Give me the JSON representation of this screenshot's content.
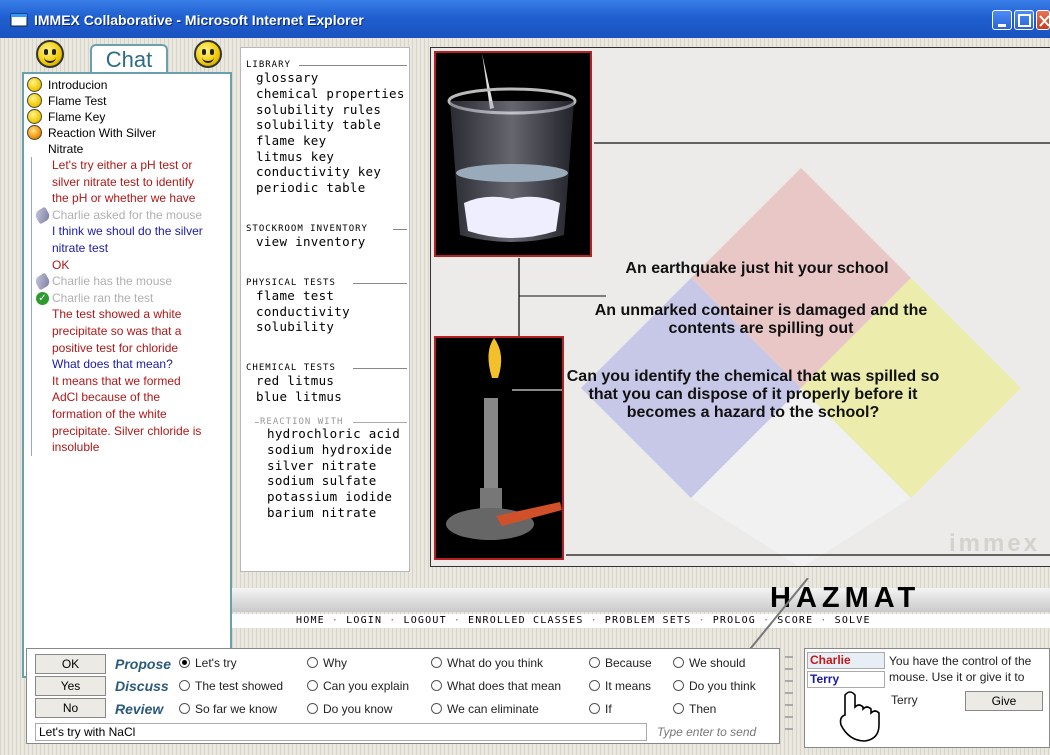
{
  "window": {
    "title": "IMMEX Collaborative - Microsoft Internet Explorer"
  },
  "chat": {
    "tab_label": "Chat",
    "topics": [
      "Introducion",
      "Flame Test",
      "Flame Key",
      "Reaction With Silver Nitrate"
    ],
    "messages": [
      {
        "text": "Let's try either a pH test or silver nitrate test to identify the pH or whether we have",
        "color": "red",
        "icon": ""
      },
      {
        "text": "Charlie asked for the mouse",
        "color": "gray",
        "icon": "mouse"
      },
      {
        "text": "I think we shoul do the silver nitrate test",
        "color": "blue",
        "icon": ""
      },
      {
        "text": "OK",
        "color": "red",
        "icon": ""
      },
      {
        "text": "Charlie has the mouse",
        "color": "gray",
        "icon": "mouse"
      },
      {
        "text": "Charlie ran the test",
        "color": "gray",
        "icon": "check"
      },
      {
        "text": "The test showed a white precipitate so was that a positive test for chloride",
        "color": "red",
        "icon": ""
      },
      {
        "text": "What does that mean?",
        "color": "blue",
        "icon": ""
      },
      {
        "text": "It means that we formed AdCl because of the formation of the white precipitate. Silver chloride is insoluble",
        "color": "red",
        "icon": ""
      }
    ]
  },
  "library": {
    "sections": {
      "library": {
        "title": "LIBRARY",
        "items": [
          "glossary",
          "chemical properties",
          "solubility rules",
          "solubility table",
          "flame key",
          "litmus key",
          "conductivity key",
          "periodic table"
        ]
      },
      "stockroom": {
        "title": "STOCKROOM INVENTORY",
        "items": [
          "view inventory"
        ]
      },
      "physical": {
        "title": "PHYSICAL TESTS",
        "items": [
          "flame test",
          "conductivity",
          "solubility"
        ]
      },
      "chemical": {
        "title": "CHEMICAL TESTS",
        "items": [
          "red litmus",
          "blue litmus"
        ]
      },
      "reaction": {
        "title": "REACTION WITH",
        "items": [
          "hydrochloric acid",
          "sodium hydroxide",
          "silver nitrate",
          "sodium sulfate",
          "potassium iodide",
          "barium nitrate"
        ]
      }
    }
  },
  "stage": {
    "line1": "An earthquake just hit your school",
    "line2": "An unmarked container is damaged and the contents are spilling out",
    "line3": "Can you identify the chemical that was spilled so that you can dispose of it properly before it becomes a hazard to the school?",
    "brand": "immex"
  },
  "hazmat_title": "HAZMAT",
  "nav": [
    "HOME",
    "LOGIN",
    "LOGOUT",
    "ENROLLED CLASSES",
    "PROBLEM SETS",
    "PROLOG",
    "SCORE",
    "SOLVE"
  ],
  "composer": {
    "buttons": [
      "OK",
      "Yes",
      "No"
    ],
    "rows": [
      {
        "label": "Propose",
        "options": [
          "Let's try",
          "Why",
          "What do you think",
          "Because",
          "We should"
        ]
      },
      {
        "label": "Discuss",
        "options": [
          "The test showed",
          "Can you explain",
          "What does that mean",
          "It means",
          "Do you think"
        ]
      },
      {
        "label": "Review",
        "options": [
          "So far we know",
          "Do you know",
          "We can eliminate",
          "If",
          "Then"
        ]
      }
    ],
    "selected": "Let's try",
    "input_value": "Let's try with NaCl",
    "send_hint": "Type enter to send"
  },
  "mouse_control": {
    "users": [
      "Charlie",
      "Terry"
    ],
    "message": "You have the control of the mouse. Use it or give it to",
    "give_to": "Terry",
    "give_label": "Give"
  },
  "colors": {
    "title_bar": "#1f5fd0",
    "chat_border": "#6a9fb0",
    "red_text": "#b01818",
    "blue_text": "#1a1aa8",
    "accent_red": "#b52020"
  }
}
